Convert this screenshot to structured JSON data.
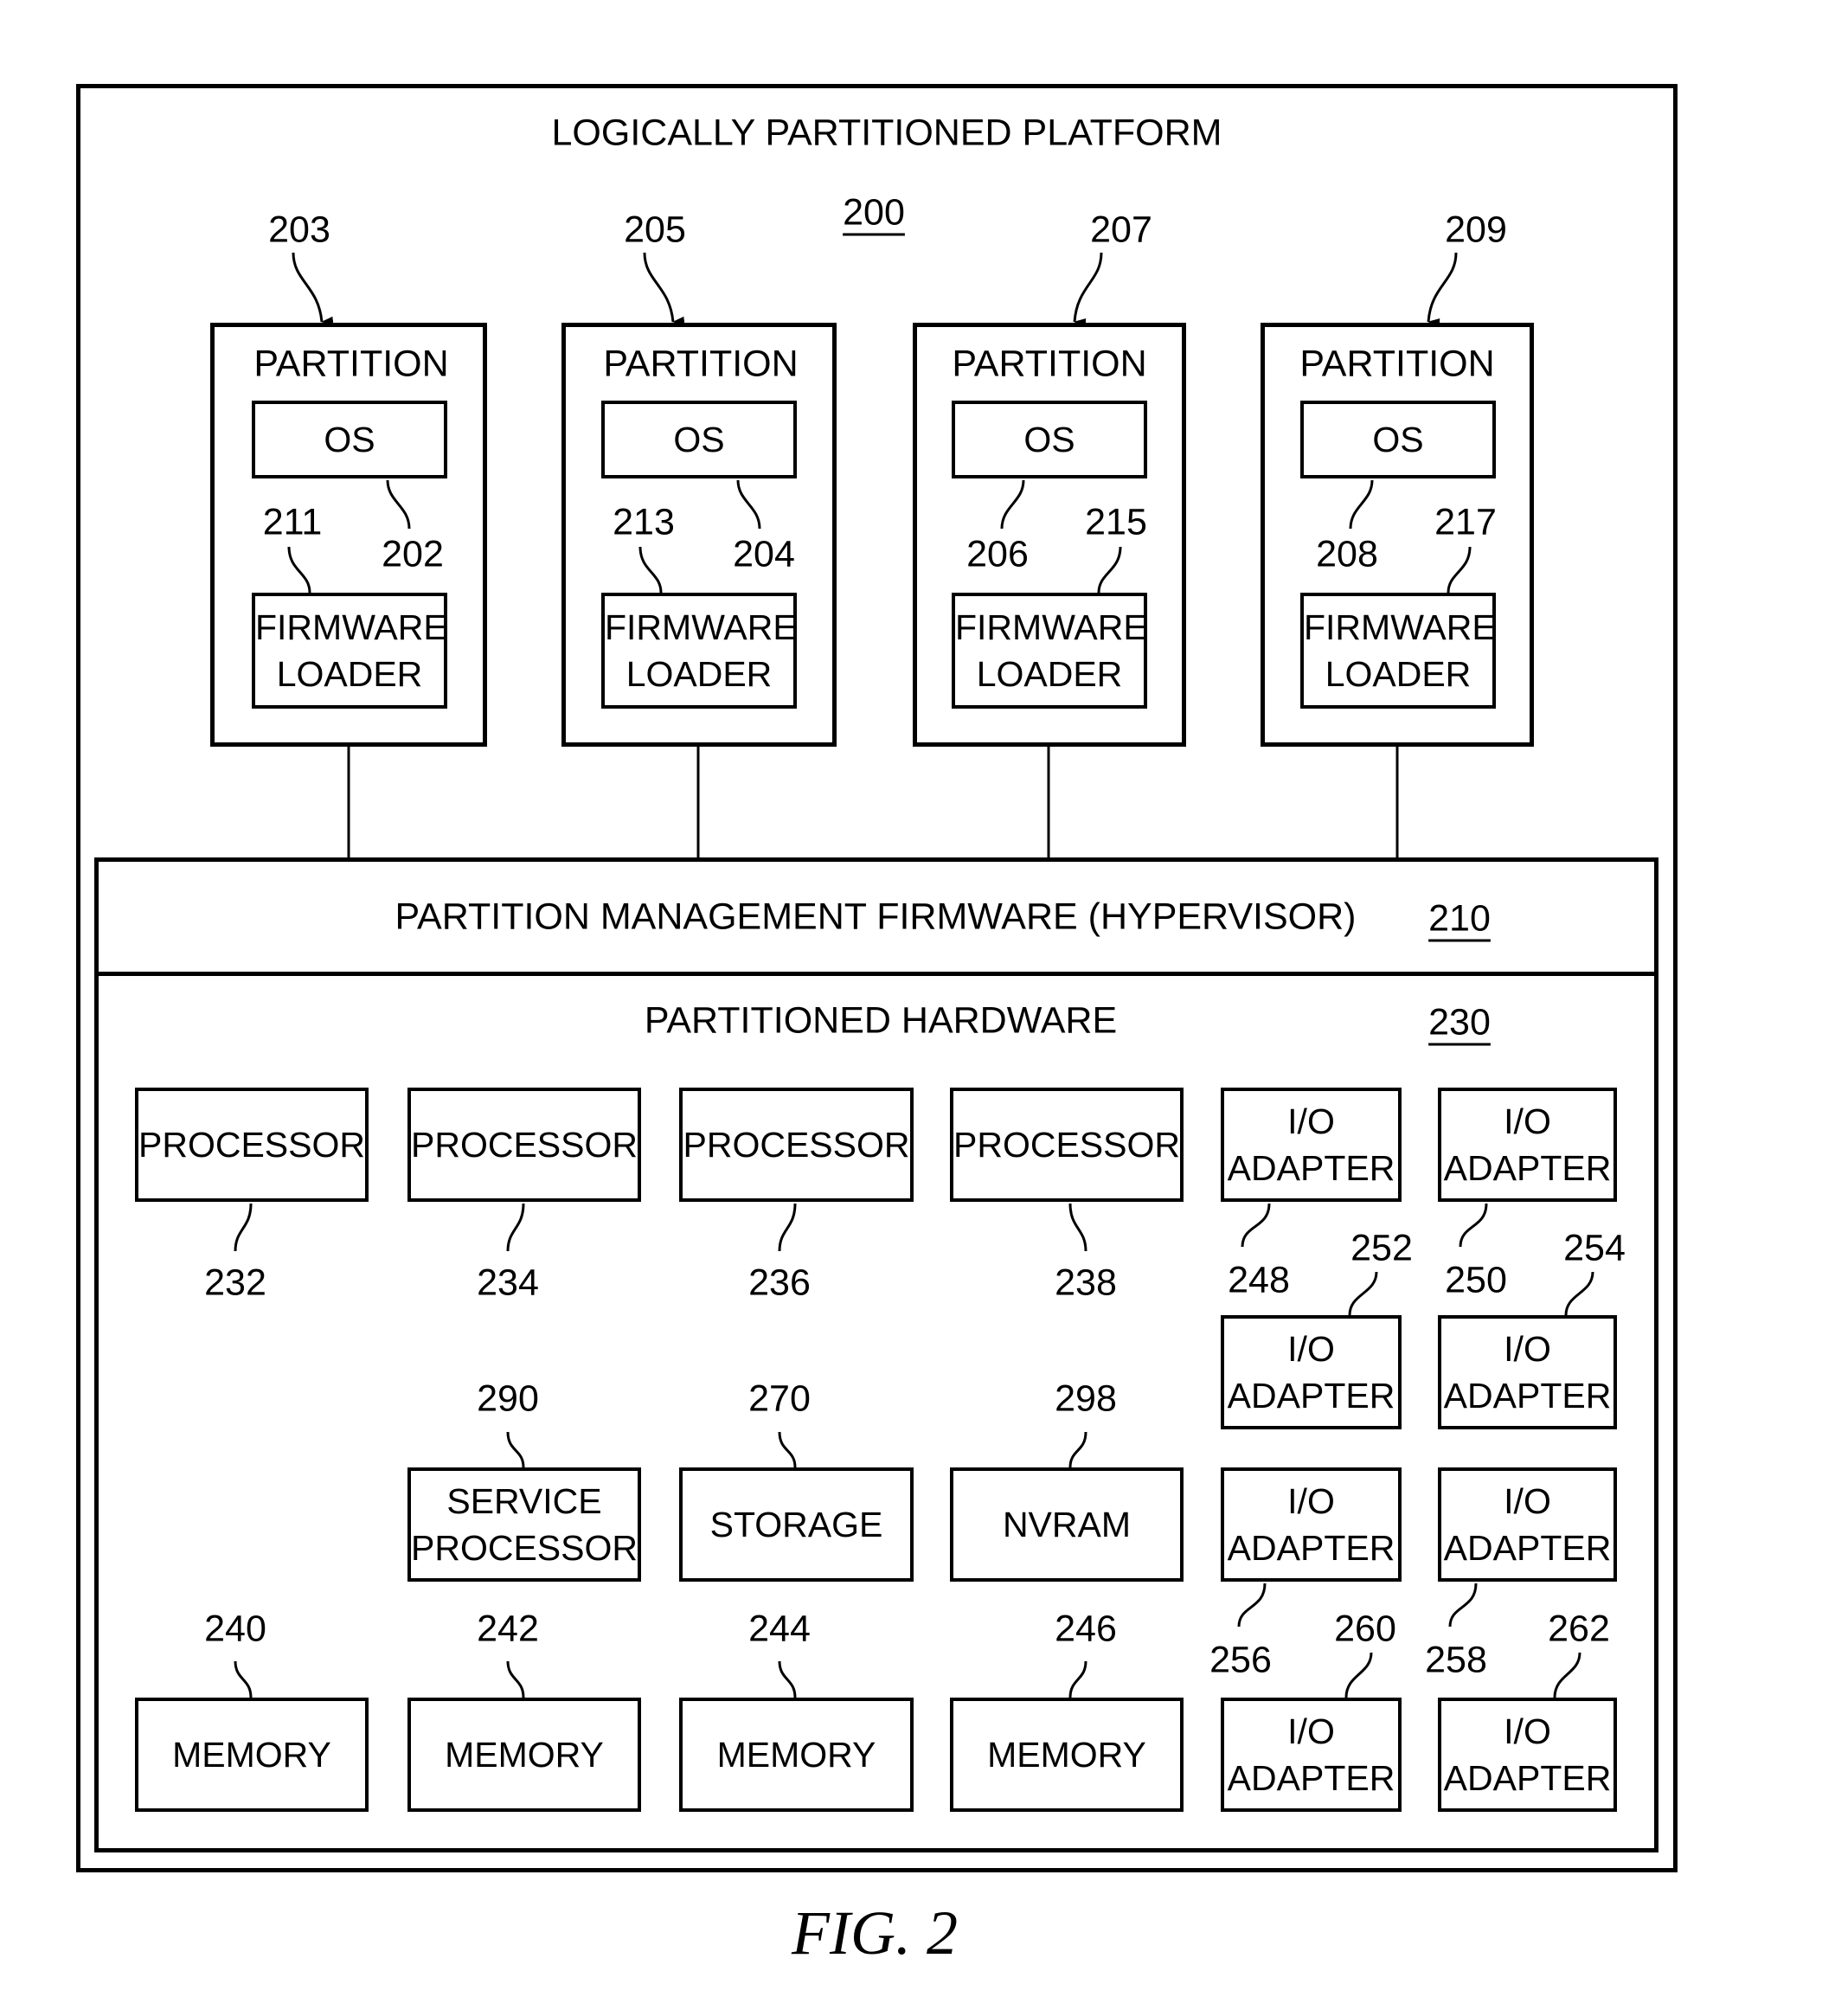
{
  "platform": {
    "title": "LOGICALLY PARTITIONED PLATFORM",
    "ref": "200"
  },
  "partitions": [
    {
      "title": "PARTITION",
      "ref": "203",
      "os_label": "OS",
      "os_ref": "202",
      "loader_label": "FIRMWARE\nLOADER",
      "loader_ref": "211"
    },
    {
      "title": "PARTITION",
      "ref": "205",
      "os_label": "OS",
      "os_ref": "204",
      "loader_label": "FIRMWARE\nLOADER",
      "loader_ref": "213"
    },
    {
      "title": "PARTITION",
      "ref": "207",
      "os_label": "OS",
      "os_ref": "206",
      "loader_label": "FIRMWARE\nLOADER",
      "loader_ref": "215"
    },
    {
      "title": "PARTITION",
      "ref": "209",
      "os_label": "OS",
      "os_ref": "208",
      "loader_label": "FIRMWARE\nLOADER",
      "loader_ref": "217"
    }
  ],
  "hypervisor": {
    "label": "PARTITION MANAGEMENT FIRMWARE (HYPERVISOR)",
    "ref": "210"
  },
  "hardware": {
    "label": "PARTITIONED HARDWARE",
    "ref": "230",
    "processors": [
      {
        "label": "PROCESSOR",
        "ref": "232"
      },
      {
        "label": "PROCESSOR",
        "ref": "234"
      },
      {
        "label": "PROCESSOR",
        "ref": "236"
      },
      {
        "label": "PROCESSOR",
        "ref": "238"
      }
    ],
    "middle": [
      {
        "label": "SERVICE\nPROCESSOR",
        "ref": "290"
      },
      {
        "label": "STORAGE",
        "ref": "270"
      },
      {
        "label": "NVRAM",
        "ref": "298"
      }
    ],
    "memories": [
      {
        "label": "MEMORY",
        "ref": "240"
      },
      {
        "label": "MEMORY",
        "ref": "242"
      },
      {
        "label": "MEMORY",
        "ref": "244"
      },
      {
        "label": "MEMORY",
        "ref": "246"
      }
    ],
    "io_adapters": [
      {
        "label": "I/O\nADAPTER",
        "ref": "248"
      },
      {
        "label": "I/O\nADAPTER",
        "ref": "250"
      },
      {
        "label": "I/O\nADAPTER",
        "ref": "252"
      },
      {
        "label": "I/O\nADAPTER",
        "ref": "254"
      },
      {
        "label": "I/O\nADAPTER",
        "ref": "256"
      },
      {
        "label": "I/O\nADAPTER",
        "ref": "258"
      },
      {
        "label": "I/O\nADAPTER",
        "ref": "260"
      },
      {
        "label": "I/O\nADAPTER",
        "ref": "262"
      }
    ]
  },
  "caption": "FIG. 2"
}
